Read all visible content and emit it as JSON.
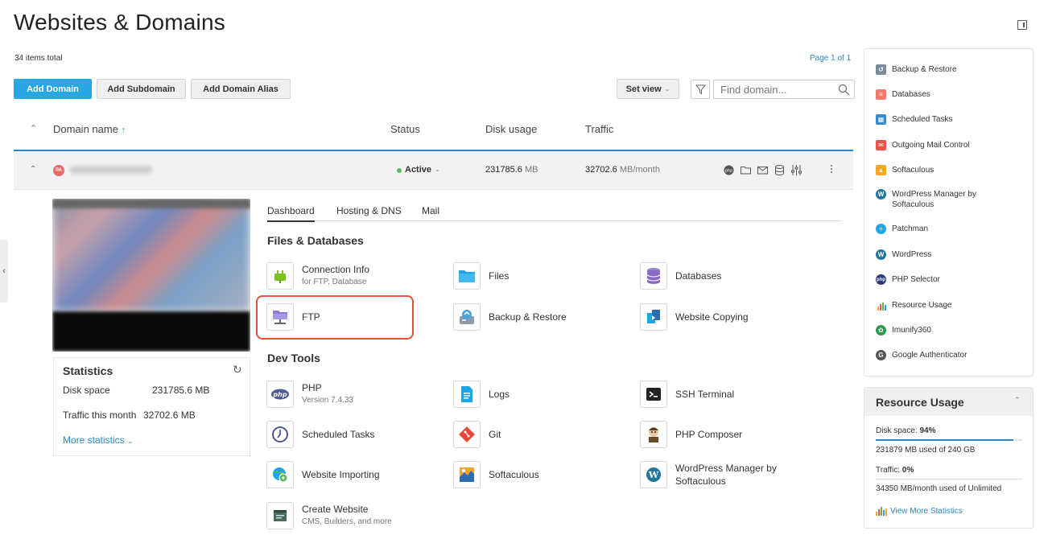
{
  "page": {
    "title": "Websites & Domains"
  },
  "list": {
    "items_total": "34 items total",
    "page_info": "Page 1 of 1",
    "add_domain": "Add Domain",
    "add_subdomain": "Add Subdomain",
    "add_domain_alias": "Add Domain Alias",
    "set_view": "Set view",
    "search_placeholder": "Find domain...",
    "columns": {
      "domain_name": "Domain name",
      "status": "Status",
      "disk_usage": "Disk usage",
      "traffic": "Traffic"
    }
  },
  "domain": {
    "badge": "PA",
    "status": "Active",
    "disk_value": "231785.6",
    "disk_unit": "MB",
    "traffic_value": "32702.6",
    "traffic_unit": "MB/month"
  },
  "stats": {
    "title": "Statistics",
    "disk_label": "Disk space",
    "disk_value": "231785.6 MB",
    "traffic_label": "Traffic this month",
    "traffic_value": "32702.6 MB",
    "more_link": "More statistics"
  },
  "tabs": [
    "Dashboard",
    "Hosting & DNS",
    "Mail"
  ],
  "sections": {
    "files_db": "Files & Databases",
    "dev_tools": "Dev Tools"
  },
  "tools": {
    "connection_info": {
      "label": "Connection Info",
      "sub": "for FTP, Database"
    },
    "files": {
      "label": "Files"
    },
    "databases": {
      "label": "Databases"
    },
    "ftp": {
      "label": "FTP"
    },
    "backup_restore": {
      "label": "Backup & Restore"
    },
    "website_copying": {
      "label": "Website Copying"
    },
    "php": {
      "label": "PHP",
      "sub": "Version 7.4.33"
    },
    "logs": {
      "label": "Logs"
    },
    "ssh_terminal": {
      "label": "SSH Terminal"
    },
    "scheduled_tasks": {
      "label": "Scheduled Tasks"
    },
    "git": {
      "label": "Git"
    },
    "php_composer": {
      "label": "PHP Composer"
    },
    "website_importing": {
      "label": "Website Importing"
    },
    "softaculous": {
      "label": "Softaculous"
    },
    "wp_manager": {
      "label": "WordPress Manager by",
      "label2": "Softaculous"
    },
    "create_website": {
      "label": "Create Website",
      "sub": "CMS, Builders, and more"
    }
  },
  "sidebar": {
    "items": [
      {
        "label": "Backup & Restore",
        "icon": "backup-icon"
      },
      {
        "label": "Databases",
        "icon": "database-icon"
      },
      {
        "label": "Scheduled Tasks",
        "icon": "calendar-icon"
      },
      {
        "label": "Outgoing Mail Control",
        "icon": "mail-icon"
      },
      {
        "label": "Softaculous",
        "icon": "softaculous-icon"
      },
      {
        "label": "WordPress Manager by",
        "label2": "Softaculous",
        "icon": "wordpress-icon"
      },
      {
        "label": "Patchman",
        "icon": "patchman-icon"
      },
      {
        "label": "WordPress",
        "icon": "wordpress-icon"
      },
      {
        "label": "PHP Selector",
        "icon": "php-icon"
      },
      {
        "label": "Resource Usage",
        "icon": "bar-chart-icon"
      },
      {
        "label": "Imunify360",
        "icon": "imunify-icon"
      },
      {
        "label": "Google Authenticator",
        "icon": "authenticator-icon"
      }
    ]
  },
  "resource_usage": {
    "title": "Resource Usage",
    "disk_label": "Disk space: ",
    "disk_percent": "94%",
    "disk_fill": 0.94,
    "disk_detail": "231879 MB used of 240 GB",
    "traffic_label": "Traffic: ",
    "traffic_percent": "0%",
    "traffic_detail": "34350 MB/month used of Unlimited",
    "view_more": "View More Statistics"
  },
  "colors": {
    "accent": "#28a8e0",
    "link": "#2a87c8",
    "highlight": "#e0523a",
    "active": "#5cb85c"
  }
}
